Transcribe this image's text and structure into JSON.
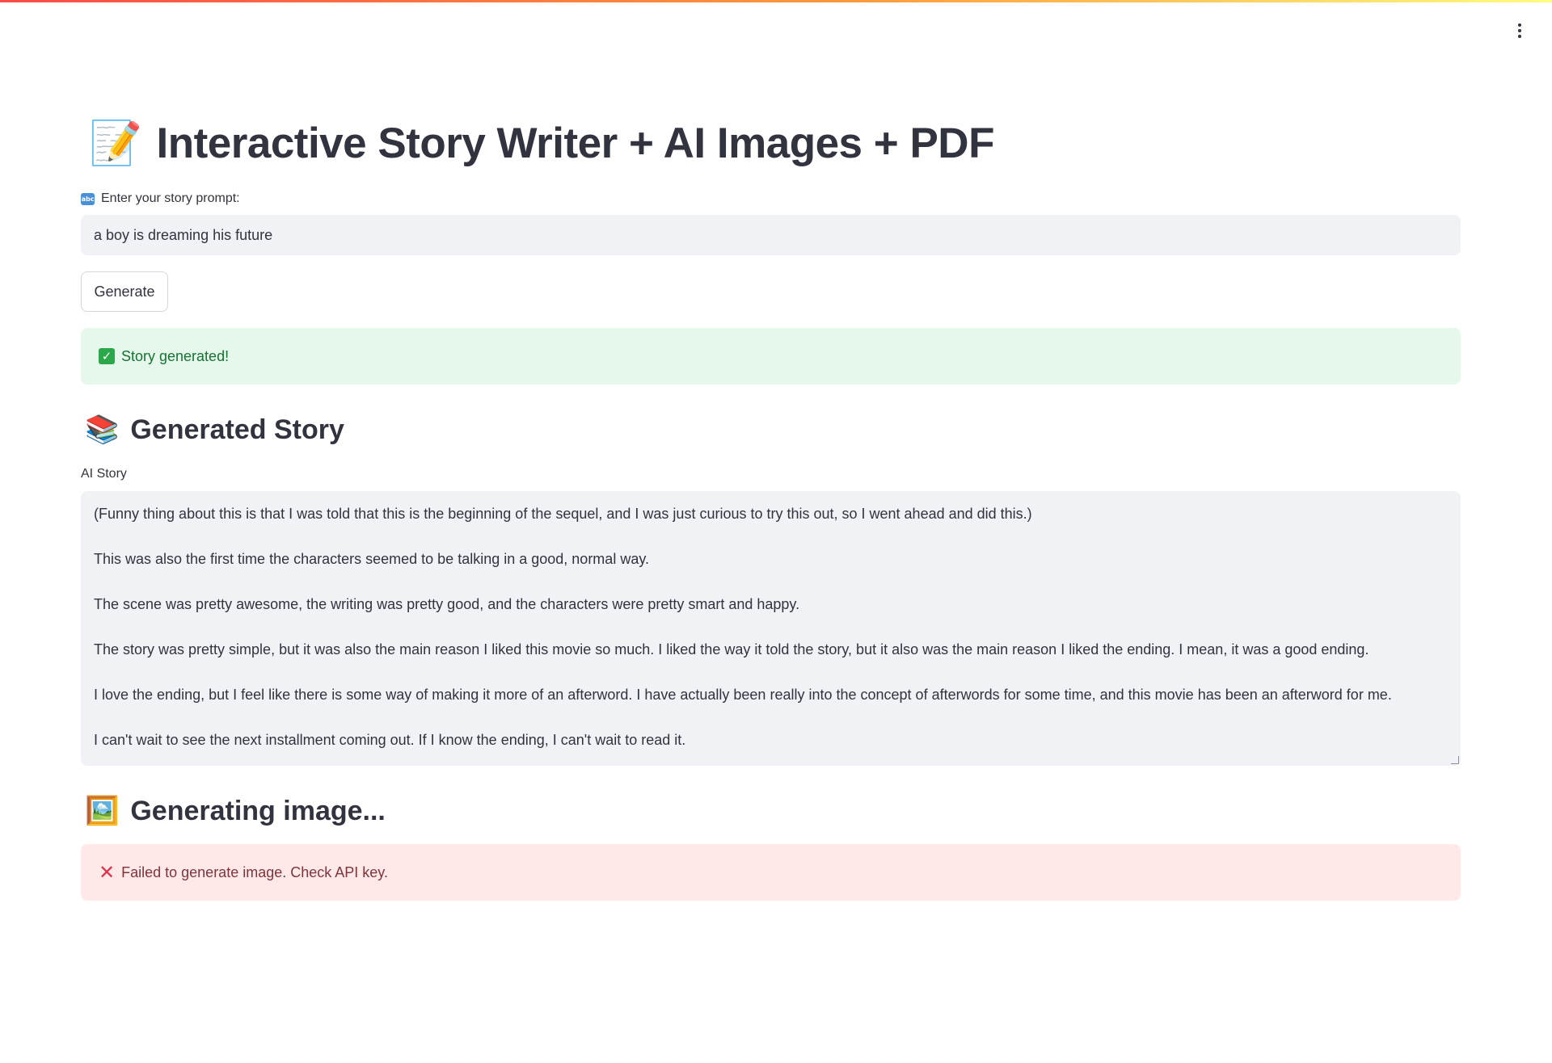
{
  "app": {
    "title_emoji": "📝",
    "title": "Interactive Story Writer + AI Images + PDF",
    "menu_icon": "more-vertical-icon"
  },
  "prompt": {
    "label_icon": "abc-icon",
    "label": "Enter your story prompt:",
    "value": "a boy is dreaming his future"
  },
  "generate_button": {
    "label": "Generate"
  },
  "success_alert": {
    "icon": "check-icon",
    "text": "Story generated!"
  },
  "story_section": {
    "emoji": "📚",
    "heading": "Generated Story",
    "field_label": "AI Story",
    "paragraphs": [
      "(Funny thing about this is that I was told that this is the beginning of the sequel, and I was just curious to try this out, so I went ahead and did this.)",
      "This was also the first time the characters seemed to be talking in a good, normal way.",
      "The scene was pretty awesome, the writing was pretty good, and the characters were pretty smart and happy.",
      "The story was pretty simple, but it was also the main reason I liked this movie so much. I liked the way it told the story, but it also was the main reason I liked the ending. I mean, it was a good ending.",
      "I love the ending, but I feel like there is some way of making it more of an afterword. I have actually been really into the concept of afterwords for some time, and this movie has been an afterword for me.",
      "I can't wait to see the next installment coming out. If I know the ending, I can't wait to read it."
    ]
  },
  "image_section": {
    "emoji": "🖼️",
    "heading": "Generating image..."
  },
  "error_alert": {
    "icon": "x-icon",
    "text": "Failed to generate image. Check API key."
  },
  "colors": {
    "text": "#31333f",
    "input_bg": "#f0f2f6",
    "success_bg": "#e6f7ec",
    "success_text": "#177233",
    "error_bg": "#ffe8e8",
    "error_text": "#7d353b"
  }
}
